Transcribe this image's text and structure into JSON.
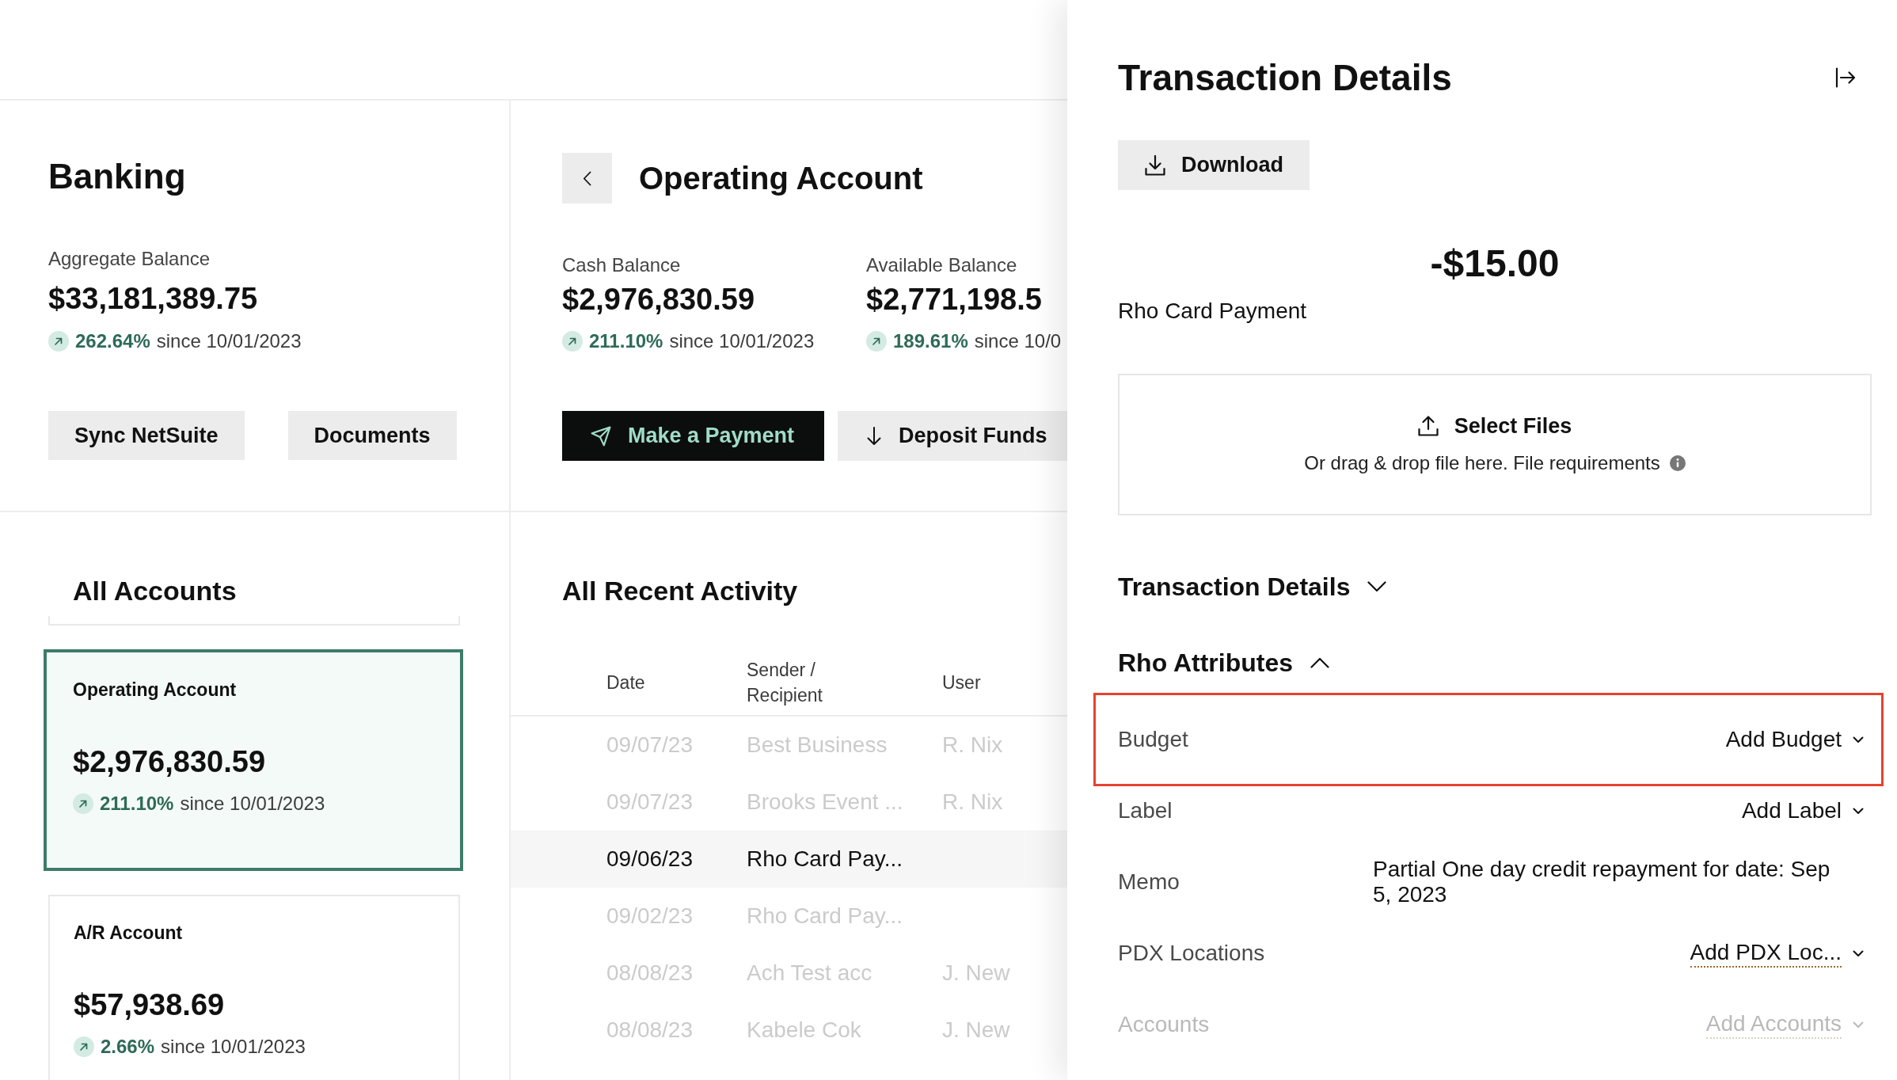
{
  "banking": {
    "title": "Banking",
    "aggregate_balance": {
      "label": "Aggregate Balance",
      "amount": "$33,181,389.75",
      "change": "262.64%",
      "period": "since 10/01/2023"
    },
    "buttons": [
      "Sync NetSuite",
      "Documents"
    ]
  },
  "all_accounts": {
    "title": "All Accounts",
    "accounts": [
      {
        "name": "Operating Account",
        "amount": "$2,976,830.59",
        "change": "211.10%",
        "period": "since 10/01/2023",
        "selected": true
      },
      {
        "name": "A/R Account",
        "amount": "$57,938.69",
        "change": "2.66%",
        "period": "since 10/01/2023",
        "selected": false
      }
    ]
  },
  "account": {
    "title": "Operating Account",
    "balances": [
      {
        "label": "Cash Balance",
        "amount": "$2,976,830.59",
        "change": "211.10%",
        "period": "since 10/01/2023"
      },
      {
        "label": "Available Balance",
        "amount": "$2,771,198.5",
        "change": "189.61%",
        "period": "since 10/0"
      }
    ],
    "actions": [
      {
        "label": "Make a Payment",
        "kind": "primary"
      },
      {
        "label": "Deposit Funds",
        "kind": "secondary"
      }
    ]
  },
  "recent_activity": {
    "title": "All Recent Activity",
    "columns": [
      "Date",
      "Sender / Recipient",
      "User"
    ],
    "rows": [
      {
        "date": "09/07/23",
        "party": "Best Business",
        "user": "R. Nix",
        "selected": false
      },
      {
        "date": "09/07/23",
        "party": "Brooks Event ...",
        "user": "R. Nix",
        "selected": false
      },
      {
        "date": "09/06/23",
        "party": "Rho Card Pay...",
        "selected": true
      },
      {
        "date": "09/02/23",
        "party": "Rho Card Pay...",
        "selected": false
      },
      {
        "date": "08/08/23",
        "party": "Ach Test acc",
        "user": "J. New",
        "selected": false
      },
      {
        "date": "08/08/23",
        "party": "Kabele Cok",
        "user": "J. New",
        "selected": false
      }
    ]
  },
  "transaction_panel": {
    "title": "Transaction Details",
    "download": "Download",
    "amount": "-$15.00",
    "description": "Rho Card Payment",
    "upload": {
      "button": "Select Files",
      "hint": "Or drag & drop file here. File requirements"
    },
    "sections": [
      {
        "title": "Transaction Details",
        "expanded": false
      },
      {
        "title": "Rho Attributes",
        "expanded": true,
        "attributes": [
          {
            "label": "Budget",
            "kind": "select",
            "value": "Add Budget",
            "highlighted": true,
            "underlined": false,
            "disabled": false
          },
          {
            "label": "Label",
            "kind": "select",
            "value": "Add Label",
            "highlighted": false,
            "underlined": false,
            "disabled": false
          },
          {
            "label": "Memo",
            "kind": "text",
            "value": "Partial One day credit repayment for date: Sep 5, 2023",
            "highlighted": false,
            "disabled": false
          },
          {
            "label": "PDX Locations",
            "kind": "select",
            "value": "Add PDX Loc...",
            "highlighted": false,
            "underlined": true,
            "disabled": false
          },
          {
            "label": "Accounts",
            "kind": "select",
            "value": "Add Accounts",
            "highlighted": false,
            "underlined": true,
            "disabled": true
          }
        ]
      }
    ]
  }
}
